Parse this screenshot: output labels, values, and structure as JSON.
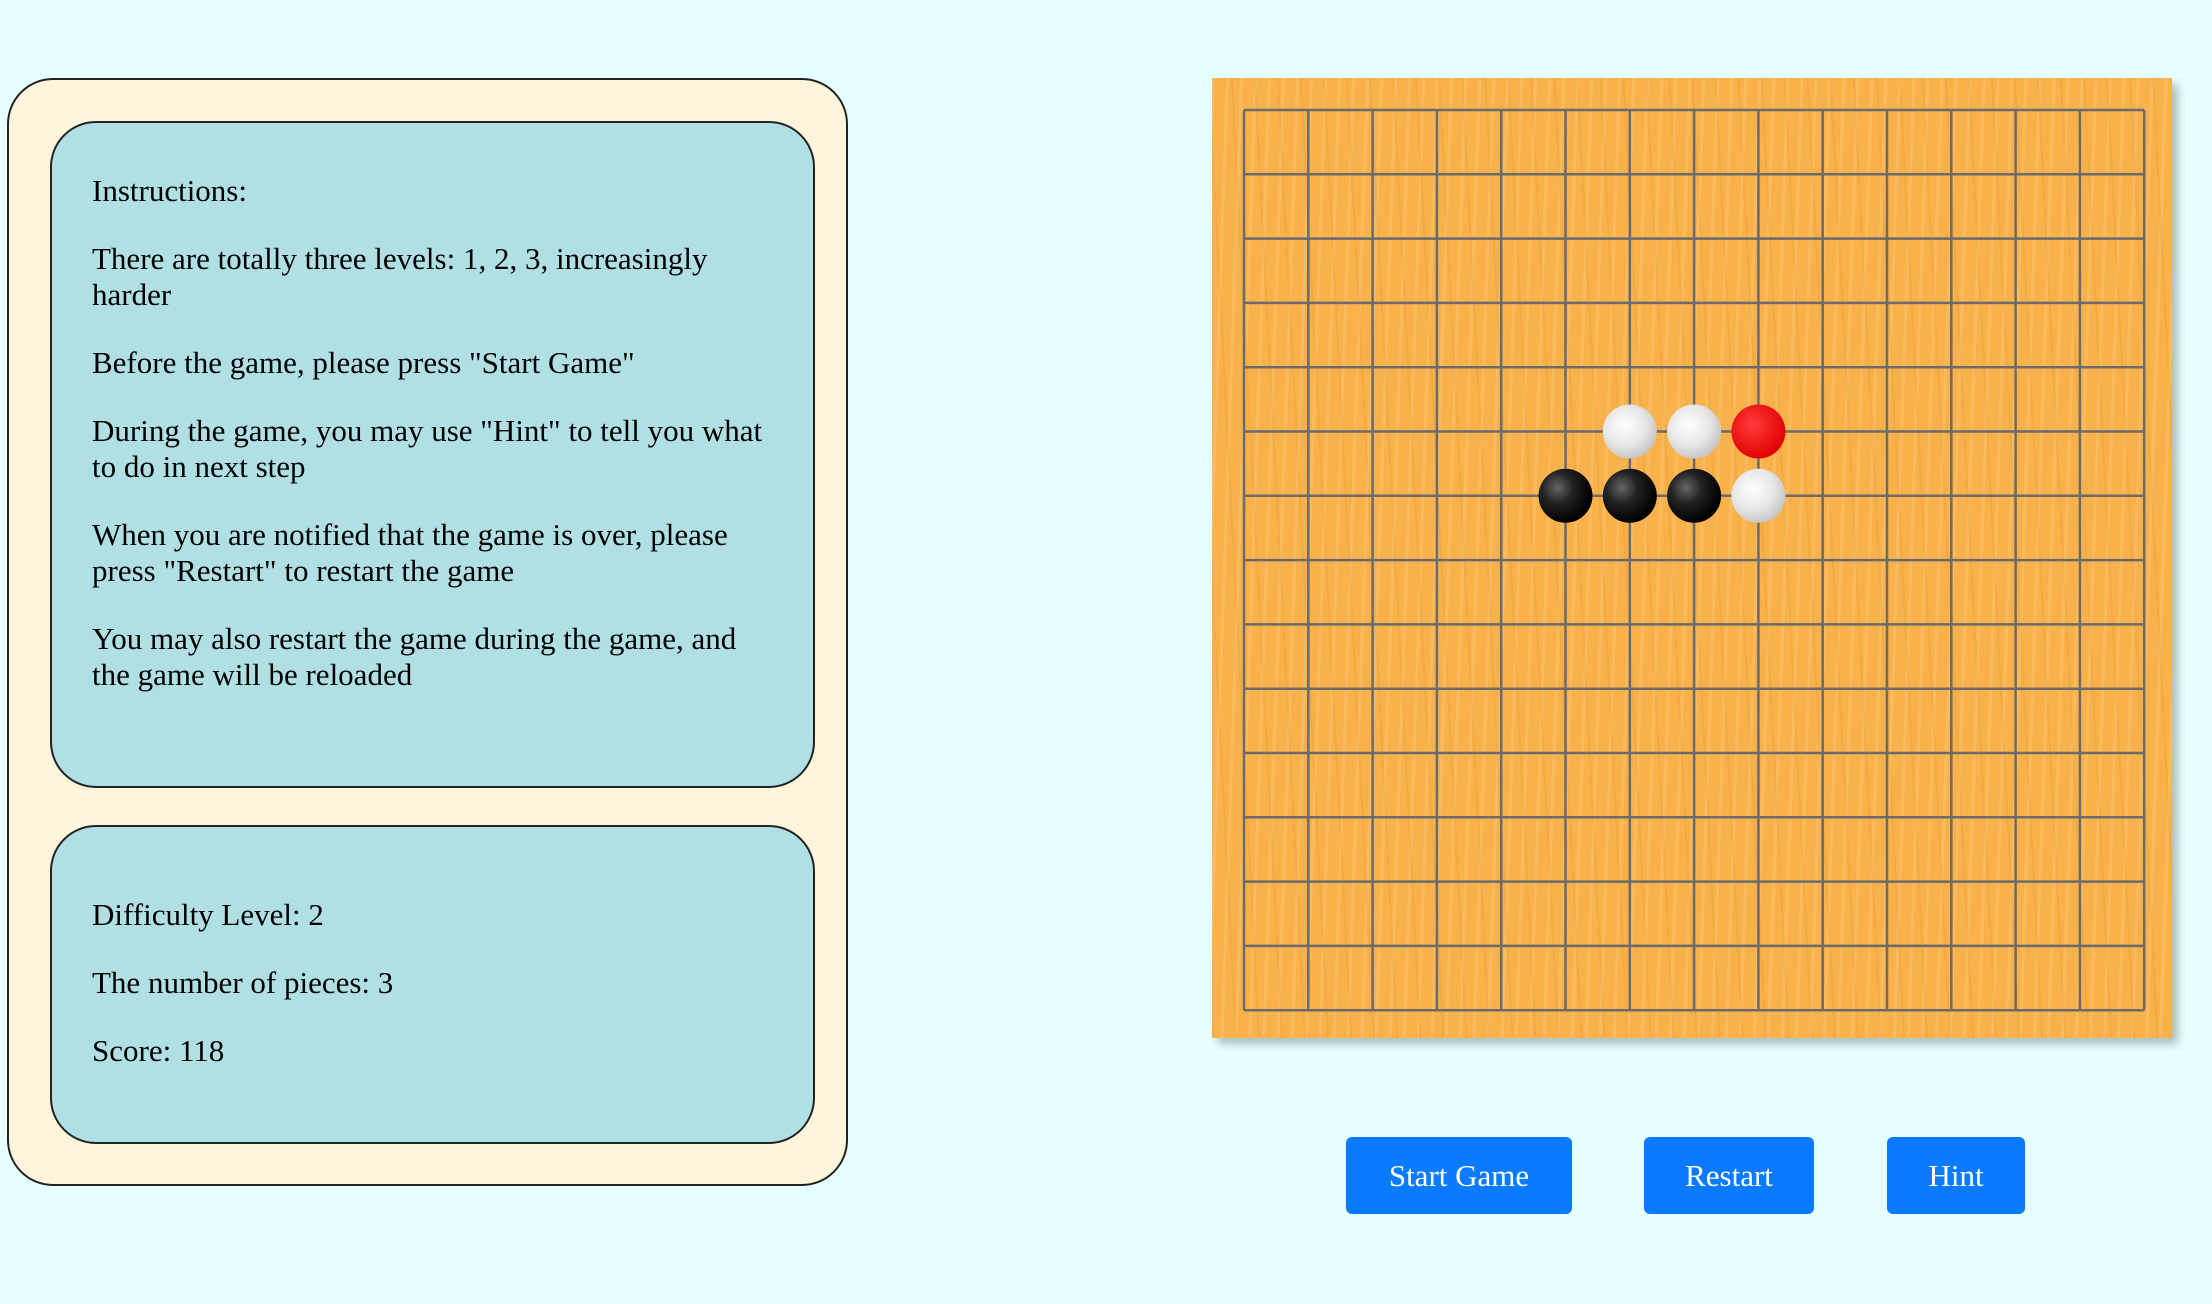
{
  "instructions": {
    "heading": "Instructions:",
    "line1": "There are totally three levels: 1, 2, 3, increasingly harder",
    "line2": "Before the game, please press \"Start Game\"",
    "line3": "During the game, you may use \"Hint\" to tell you what to do in next step",
    "line4": "When you are notified that the game is over, please press \"Restart\" to restart the game",
    "line5": "You may also restart the game during the game, and the game will be reloaded"
  },
  "status": {
    "difficulty": "Difficulty Level: 2",
    "pieces": "The number of pieces: 3",
    "score": "Score: 118"
  },
  "board": {
    "lines": 15,
    "stones": [
      {
        "col": 6,
        "row": 5,
        "color": "white"
      },
      {
        "col": 7,
        "row": 5,
        "color": "white"
      },
      {
        "col": 8,
        "row": 5,
        "color": "red"
      },
      {
        "col": 5,
        "row": 6,
        "color": "black"
      },
      {
        "col": 6,
        "row": 6,
        "color": "black"
      },
      {
        "col": 7,
        "row": 6,
        "color": "black"
      },
      {
        "col": 8,
        "row": 6,
        "color": "white"
      }
    ]
  },
  "buttons": {
    "start": "Start Game",
    "restart": "Restart",
    "hint": "Hint"
  },
  "colors": {
    "background": "#e6ffff",
    "panel": "#fff5dc",
    "info_box": "#b0dfe4",
    "board_wood": "#f9b24b",
    "button": "#0a7bff"
  }
}
